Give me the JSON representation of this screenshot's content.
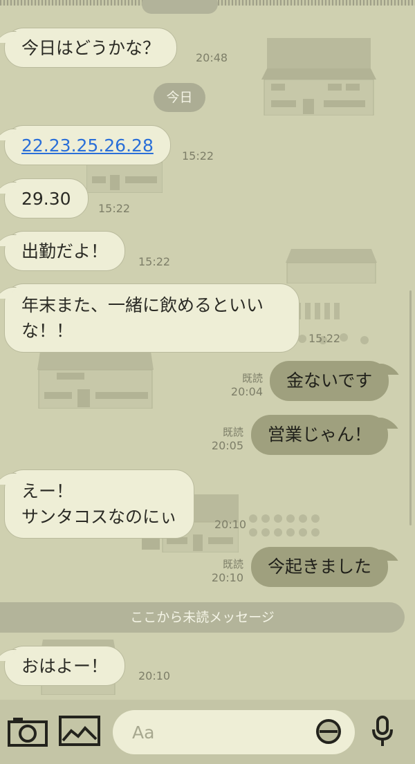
{
  "messages": [
    {
      "id": "m1",
      "dir": "in",
      "text": "今日はどうかな？",
      "time": "20:48"
    },
    {
      "id": "m2",
      "dir": "in",
      "link": "22.23.25.26.28",
      "time": "15:22"
    },
    {
      "id": "m3",
      "dir": "in",
      "text": "29.30",
      "time": "15:22"
    },
    {
      "id": "m4",
      "dir": "in",
      "text": "出勤だよ！",
      "time": "15:22"
    },
    {
      "id": "m5",
      "dir": "in",
      "lines": [
        "年末また、一緒に飲めるといい",
        "な！！"
      ],
      "time": "15:22"
    },
    {
      "id": "m6",
      "dir": "out",
      "text": "金ないです",
      "read": "既読",
      "time": "20:04"
    },
    {
      "id": "m7",
      "dir": "out",
      "text": "営業じゃん！",
      "read": "既読",
      "time": "20:05"
    },
    {
      "id": "m8",
      "dir": "in",
      "lines": [
        "えー！",
        "サンタコスなのにぃ"
      ],
      "time": "20:10"
    },
    {
      "id": "m9",
      "dir": "out",
      "text": "今起きました",
      "read": "既読",
      "time": "20:10"
    },
    {
      "id": "m10",
      "dir": "in",
      "text": "おはよー！",
      "time": "20:10"
    }
  ],
  "date_separator": "今日",
  "unread_separator": "ここから未読メッセージ",
  "input": {
    "placeholder": "Aa",
    "value": ""
  },
  "icons": [
    "camera-icon",
    "photo-icon",
    "sticker-icon",
    "microphone-icon"
  ],
  "colors": {
    "background": "#cfd0b0",
    "incoming_bubble": "#eeeed6",
    "outgoing_bubble": "#9fa07e",
    "link": "#2a6fd8"
  }
}
